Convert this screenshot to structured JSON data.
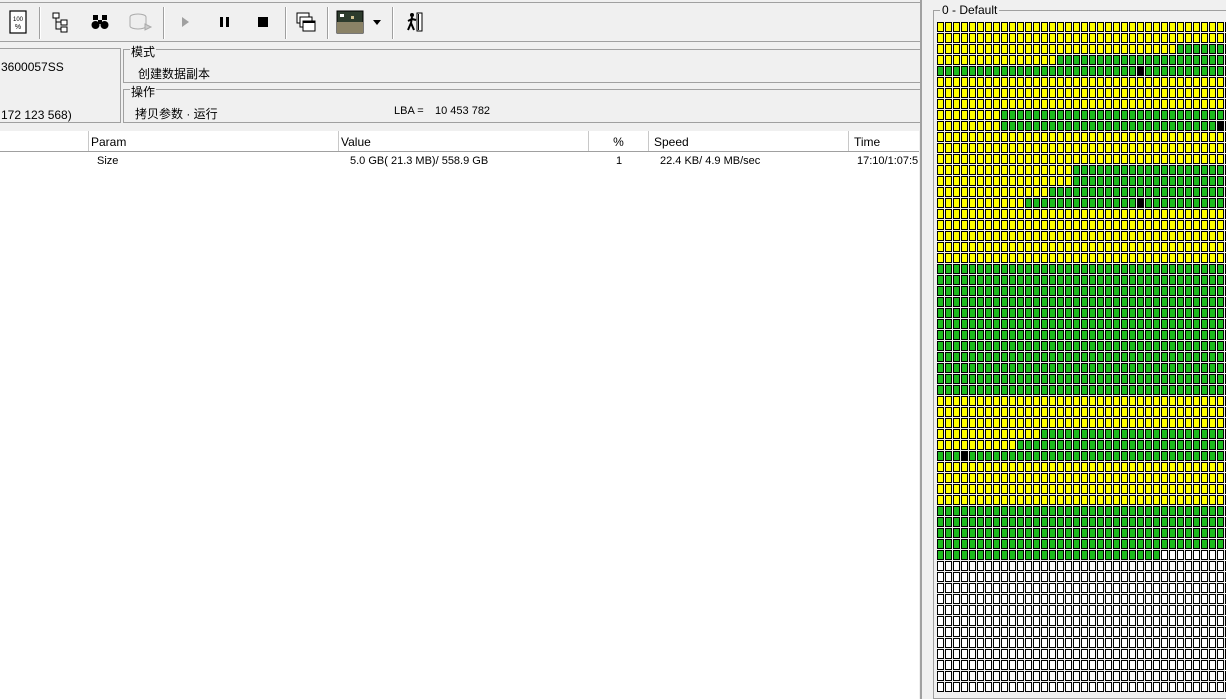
{
  "toolbar": {
    "buttons": [
      {
        "name": "hundred-percent-icon",
        "enabled": true
      },
      {
        "name": "tree-view-icon",
        "enabled": true
      },
      {
        "name": "binoculars-icon",
        "enabled": true
      },
      {
        "name": "disk-map-icon",
        "enabled": false
      },
      {
        "name": "play-icon",
        "enabled": false
      },
      {
        "name": "pause-icon",
        "enabled": true
      },
      {
        "name": "stop-icon",
        "enabled": true
      },
      {
        "name": "windows-icon",
        "enabled": true
      },
      {
        "name": "palette-icon",
        "enabled": true
      },
      {
        "name": "dropdown-arrow-icon",
        "enabled": true
      },
      {
        "name": "exit-icon",
        "enabled": true
      }
    ]
  },
  "info": {
    "model": "3600057SS",
    "lba_count": "172 123 568)"
  },
  "mode": {
    "label": "模式",
    "value": "创建数据副本"
  },
  "operation": {
    "label": "操作",
    "value": "拷贝参数 · 运行",
    "lba_label": "LBA =",
    "lba_value": "10 453 782"
  },
  "table": {
    "columns": [
      "Param",
      "Value",
      "%",
      "Speed",
      "Time"
    ],
    "rows": [
      {
        "param": "Size",
        "value": "5.0 GB( 21.3 MB)/ 558.9 GB",
        "percent": "1",
        "speed": "22.4 KB/ 4.9 MB/sec",
        "time": "17:10/1:07:5"
      }
    ]
  },
  "map": {
    "title": "0 - Default",
    "columns": 37,
    "rows": 61,
    "legend": {
      "w": "empty",
      "y": "read",
      "g": "copied",
      "k": "error"
    },
    "colors": {
      "w": "#ffffff",
      "y": "#ffff00",
      "g": "#1dbb1d",
      "k": "#000000"
    },
    "row_runs": [
      "y37",
      "y37",
      "y30g7",
      "y15g21y1",
      "g25k1g11",
      "y37",
      "y37",
      "y37",
      "y8g28y1",
      "y8g27k1g1",
      "y37",
      "y37",
      "y37",
      "y17g20",
      "y17g20",
      "y14g23",
      "y11g14k1g11",
      "y37",
      "y37",
      "y37",
      "y37",
      "y37",
      "g37",
      "g37",
      "g37",
      "g37",
      "g37",
      "g37",
      "g37",
      "g37",
      "g37",
      "g37",
      "g37",
      "g36k1",
      "y37",
      "y37",
      "y37",
      "y13g24",
      "y10g27",
      "g3k1g33",
      "y37",
      "y37",
      "y37",
      "y37",
      "g37",
      "g37",
      "g37",
      "g37",
      "g28w9",
      "w37",
      "w37",
      "w37",
      "w37",
      "w37",
      "w37",
      "w37",
      "w37",
      "w37",
      "w37",
      "w37",
      "w37"
    ]
  }
}
